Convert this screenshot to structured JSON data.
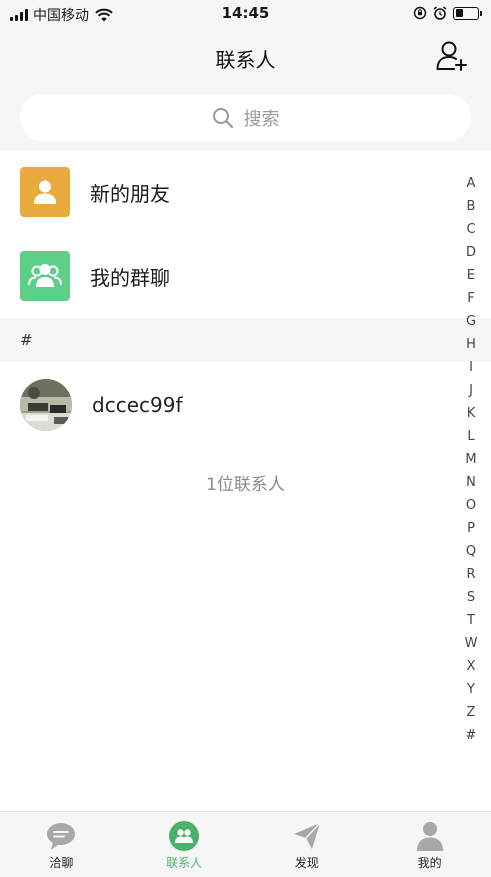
{
  "status_bar": {
    "carrier": "中国移动",
    "time": "14:45",
    "battery_level": 0.35
  },
  "nav": {
    "title": "联系人"
  },
  "search": {
    "placeholder": "搜索"
  },
  "entries": [
    {
      "label": "新的朋友",
      "icon": "person-icon",
      "color": "#e9a93c"
    },
    {
      "label": "我的群聊",
      "icon": "group-icon",
      "color": "#5dcf87"
    }
  ],
  "section": {
    "header": "#"
  },
  "contacts": [
    {
      "name": "dccec99f",
      "avatar": "photo-avatar"
    }
  ],
  "contact_count": "1位联系人",
  "index_letters": [
    "A",
    "B",
    "C",
    "D",
    "E",
    "F",
    "G",
    "H",
    "I",
    "J",
    "K",
    "L",
    "M",
    "N",
    "O",
    "P",
    "Q",
    "R",
    "S",
    "T",
    "W",
    "X",
    "Y",
    "Z",
    "#"
  ],
  "tabs": [
    {
      "label": "洽聊",
      "icon": "chat-bubble-icon",
      "active": false
    },
    {
      "label": "联系人",
      "icon": "contacts-icon",
      "active": true
    },
    {
      "label": "发现",
      "icon": "paper-plane-icon",
      "active": false
    },
    {
      "label": "我的",
      "icon": "profile-icon",
      "active": false
    }
  ],
  "colors": {
    "accent": "#4cb26a",
    "background": "#f6f6f7"
  }
}
